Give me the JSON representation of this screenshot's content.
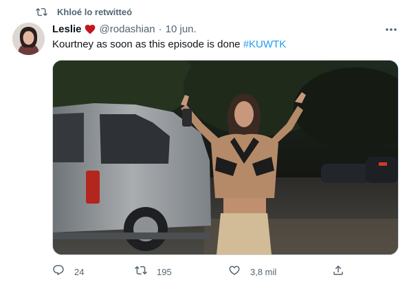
{
  "retweet": {
    "label": "Khloé lo retwitteó",
    "icon": "retweet-icon"
  },
  "author": {
    "name": "Leslie",
    "emoji_icon": "red-heart-icon",
    "handle": "@rodashian",
    "separator": "·",
    "date": "10 jun."
  },
  "tweet": {
    "text": "Kourtney as soon as this episode is done",
    "hashtag": "#KUWTK"
  },
  "actions": {
    "reply_count": "24",
    "retweet_count": "195",
    "like_count": "3,8 mil"
  },
  "colors": {
    "accent": "#1d9bf0",
    "secondary_text": "#536471",
    "heart": "#c4161c"
  }
}
